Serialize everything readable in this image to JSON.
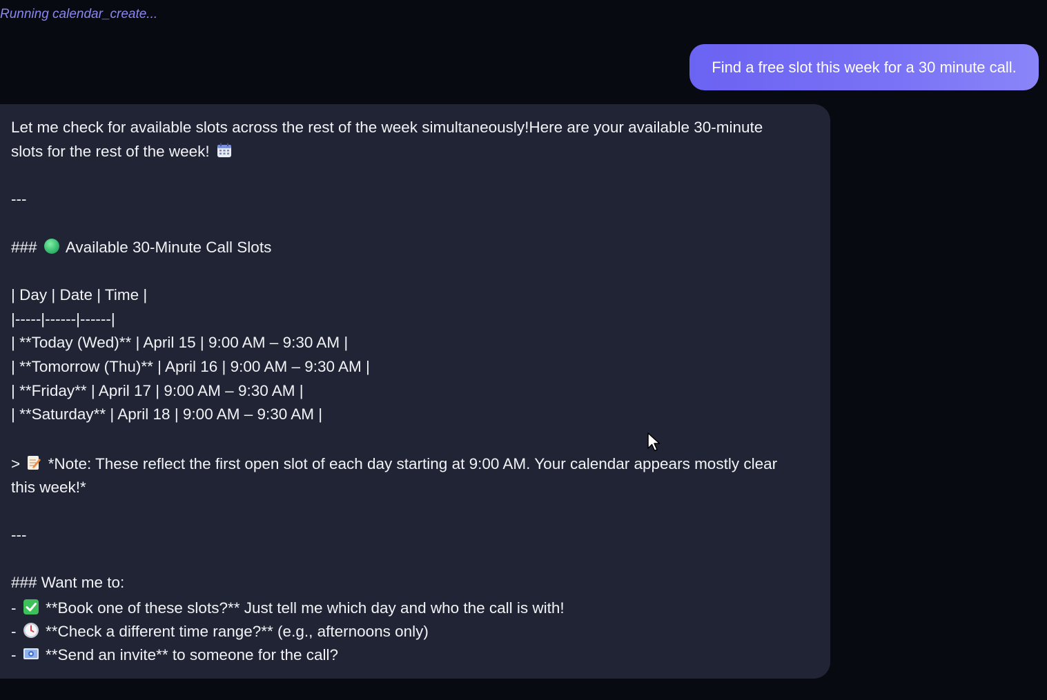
{
  "status": {
    "text": "Running calendar_create..."
  },
  "user_message": {
    "text": "Find a free slot this week for a 30 minute call."
  },
  "assistant_message": {
    "intro_line1": "Let me check for available slots across the rest of the week simultaneously!Here are your available 30-minute",
    "intro_line2": "slots for the rest of the week!",
    "divider1": "---",
    "heading1_prefix": "###",
    "heading1_text": "Available 30-Minute Call Slots",
    "table_header": "| Day | Date | Time |",
    "table_separator": "|-----|------|------|",
    "table_rows": [
      "| **Today (Wed)** | April 15 | 9:00 AM – 9:30 AM |",
      "| **Tomorrow (Thu)** | April 16 | 9:00 AM – 9:30 AM |",
      "| **Friday** | April 17 | 9:00 AM – 9:30 AM |",
      "| **Saturday** | April 18 | 9:00 AM – 9:30 AM |"
    ],
    "note_prefix": ">",
    "note_line1": "*Note: These reflect the first open slot of each day starting at 9:00 AM. Your calendar appears mostly clear",
    "note_line2": "this week!*",
    "divider2": "---",
    "heading2": "### Want me to:",
    "options": [
      {
        "prefix": "-",
        "icon": "check-mark-icon",
        "text": "**Book one of these slots?** Just tell me which day and who the call is with!"
      },
      {
        "prefix": "-",
        "icon": "clock-icon",
        "text": "**Check a different time range?** (e.g., afternoons only)"
      },
      {
        "prefix": "-",
        "icon": "envelope-icon",
        "text": "**Send an invite** to someone for the call?"
      }
    ],
    "icons": {
      "calendar": "calendar-icon",
      "green_circle": "green-circle-icon",
      "memo": "memo-icon"
    }
  },
  "colors": {
    "background": "#080a12",
    "assistant_bubble": "#202434",
    "user_bubble": "#6f68f4",
    "status_text": "#8b87f0",
    "text": "#f2f3f7"
  }
}
